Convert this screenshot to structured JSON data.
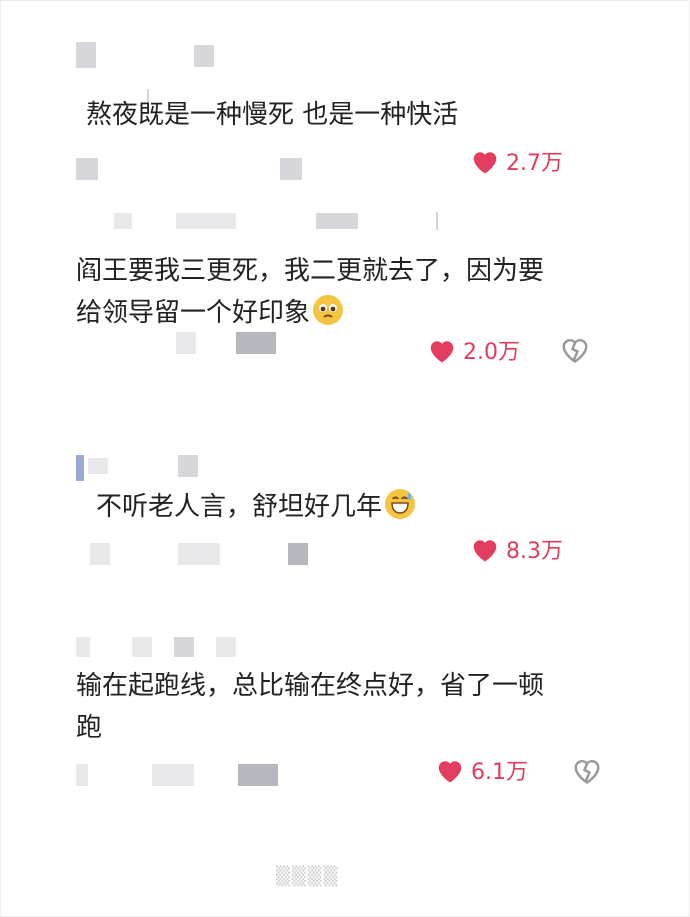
{
  "comments": [
    {
      "text_lines": [
        "熬夜既是一种慢死 也是一种快活"
      ],
      "likes": "2.7万",
      "emoji": ""
    },
    {
      "text_lines": [
        "阎王要我三更死，我二更就去了，因为要",
        "给领导留一个好印象"
      ],
      "likes": "2.0万",
      "emoji": "pleading-face"
    },
    {
      "text_lines": [
        "不听老人言，舒坦好几年"
      ],
      "likes": "8.3万",
      "emoji": "grinning-sweat-face"
    },
    {
      "text_lines": [
        "输在起跑线，总比输在终点好，省了一顿",
        "跑"
      ],
      "likes": "6.1万",
      "emoji": ""
    }
  ],
  "icons": {
    "like": "heart-icon",
    "dislike": "broken-heart-icon"
  },
  "colors": {
    "like": "#e23d5f",
    "text": "#222222",
    "blur": "#c9c9cf"
  }
}
